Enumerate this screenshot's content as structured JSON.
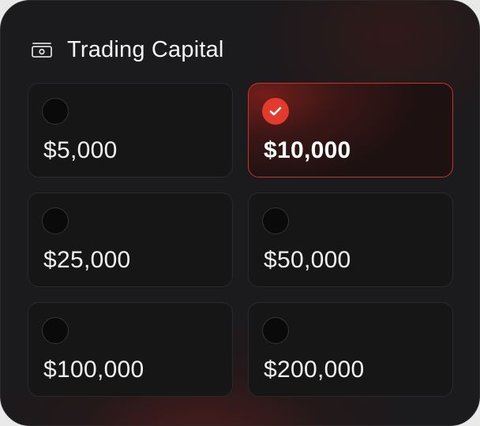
{
  "header": {
    "title": "Trading Capital",
    "icon": "banknote-icon"
  },
  "options": [
    {
      "label": "$5,000",
      "selected": false
    },
    {
      "label": "$10,000",
      "selected": true
    },
    {
      "label": "$25,000",
      "selected": false
    },
    {
      "label": "$50,000",
      "selected": false
    },
    {
      "label": "$100,000",
      "selected": false
    },
    {
      "label": "$200,000",
      "selected": false
    }
  ],
  "colors": {
    "accent": "#e23a2c",
    "background": "#1b1a1c",
    "tile": "#161617"
  }
}
